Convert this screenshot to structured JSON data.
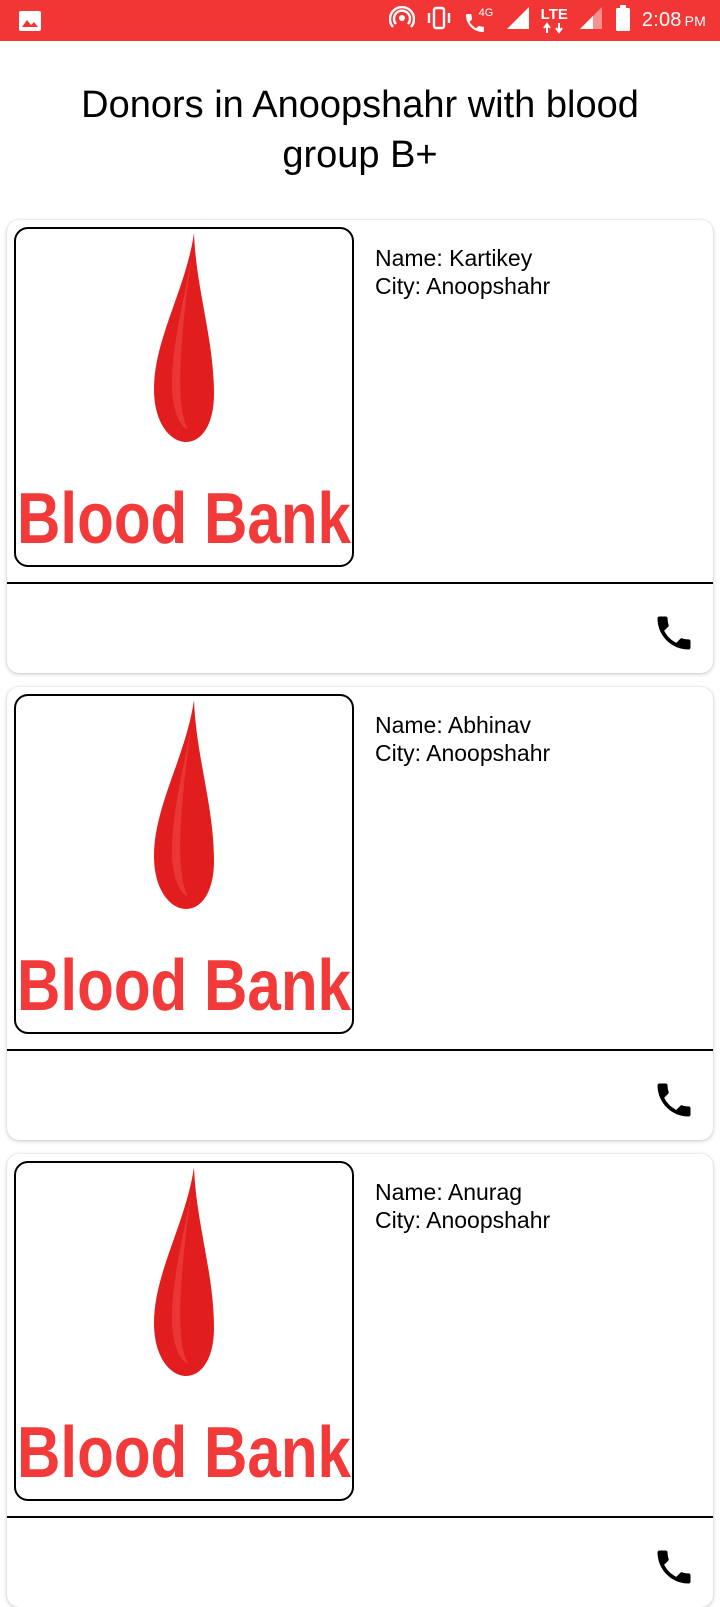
{
  "status_bar": {
    "time": "2:08",
    "ampm": "PM",
    "network_4g": "4G",
    "network_lte": "LTE",
    "icons": [
      "image-icon",
      "hotspot-icon",
      "vibrate-icon",
      "wifi-call-icon",
      "signal-icon",
      "lte-icon",
      "signal-icon",
      "battery-icon"
    ]
  },
  "page": {
    "title": "Donors in Anoopshahr with blood group B+"
  },
  "logo": {
    "text": "Blood Bank",
    "color": "#f33a3a"
  },
  "donors": [
    {
      "name": "Name: Kartikey",
      "city": "City: Anoopshahr"
    },
    {
      "name": "Name: Abhinav",
      "city": "City: Anoopshahr"
    },
    {
      "name": "Name: Anurag",
      "city": "City: Anoopshahr"
    }
  ],
  "colors": {
    "status_bar": "#f23535",
    "accent": "#e21d1d"
  }
}
